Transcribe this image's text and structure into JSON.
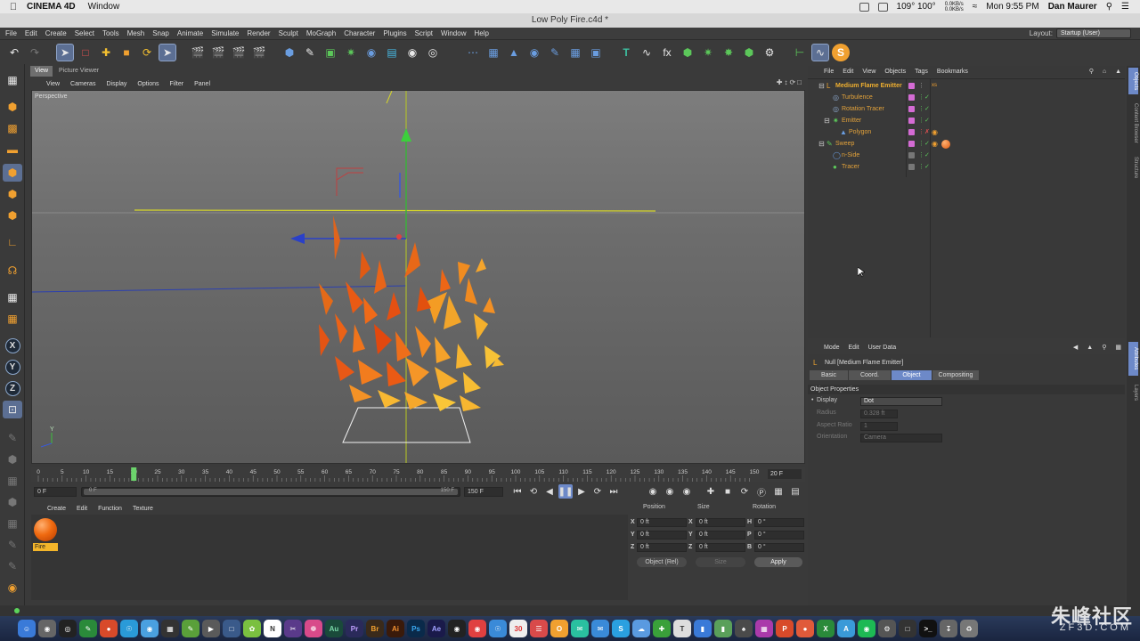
{
  "mac_menubar": {
    "app_name": "CINEMA 4D",
    "menu": "Window",
    "status_right": {
      "temperature": "109° 100°",
      "network_up": "0.0KB/s",
      "network_down": "0.0KB/s",
      "clock": "Mon 9:55 PM",
      "user": "Dan Maurer"
    }
  },
  "window": {
    "title": "Low Poly Fire.c4d *"
  },
  "app_menu": [
    "File",
    "Edit",
    "Create",
    "Select",
    "Tools",
    "Mesh",
    "Snap",
    "Animate",
    "Simulate",
    "Render",
    "Sculpt",
    "MoGraph",
    "Character",
    "Plugins",
    "Script",
    "Window",
    "Help"
  ],
  "layout": {
    "label": "Layout:",
    "value": "Startup (User)"
  },
  "viewport": {
    "tabs": [
      "View",
      "Picture Viewer"
    ],
    "menu": [
      "View",
      "Cameras",
      "Display",
      "Options",
      "Filter",
      "Panel"
    ],
    "camera_label": "Perspective",
    "axis_y": "Y"
  },
  "timeline": {
    "ticks": [
      "0",
      "5",
      "10",
      "15",
      "20",
      "25",
      "30",
      "35",
      "40",
      "45",
      "50",
      "55",
      "60",
      "65",
      "70",
      "75",
      "80",
      "85",
      "90",
      "95",
      "100",
      "105",
      "110",
      "115",
      "120",
      "125",
      "130",
      "135",
      "140",
      "145",
      "150"
    ],
    "current_frame": "20 F",
    "playhead_frame": 20,
    "start": "0 F",
    "range_start": "0 F",
    "range_end": "150 F",
    "end": "150 F"
  },
  "material_manager": {
    "menu": [
      "Create",
      "Edit",
      "Function",
      "Texture"
    ],
    "material_name": "Fire"
  },
  "coord_manager": {
    "headers": [
      "Position",
      "Size",
      "Rotation"
    ],
    "rows": [
      {
        "axis": "X",
        "pos": "0 ft",
        "size_axis": "X",
        "size": "0 ft",
        "rot_axis": "H",
        "rot": "0 °"
      },
      {
        "axis": "Y",
        "pos": "0 ft",
        "size_axis": "Y",
        "size": "0 ft",
        "rot_axis": "P",
        "rot": "0 °"
      },
      {
        "axis": "Z",
        "pos": "0 ft",
        "size_axis": "Z",
        "size": "0 ft",
        "rot_axis": "B",
        "rot": "0 °"
      }
    ],
    "mode": "Object (Rel)",
    "size_mode": "Size",
    "apply": "Apply"
  },
  "object_manager": {
    "menu": [
      "File",
      "Edit",
      "View",
      "Objects",
      "Tags",
      "Bookmarks"
    ],
    "objects": [
      {
        "name": "Medium Flame Emitter",
        "icon": "null-icon"
      },
      {
        "name": "Turbulence",
        "icon": "turbulence-icon"
      },
      {
        "name": "Rotation Tracer",
        "icon": "tracer-icon"
      },
      {
        "name": "Emitter",
        "icon": "emitter-icon"
      },
      {
        "name": "Polygon",
        "icon": "polygon-icon"
      },
      {
        "name": "Sweep",
        "icon": "sweep-icon"
      },
      {
        "name": "n-Side",
        "icon": "nside-icon"
      },
      {
        "name": "Tracer",
        "icon": "tracer-icon"
      }
    ]
  },
  "attribute_manager": {
    "menu": [
      "Mode",
      "Edit",
      "User Data"
    ],
    "title": "Null [Medium Flame Emitter]",
    "tabs": [
      "Basic",
      "Coord.",
      "Object",
      "Compositing"
    ],
    "active_tab": "Object",
    "section": "Object Properties",
    "props": [
      {
        "label": "Display",
        "value": "Dot"
      },
      {
        "label": "Radius",
        "value": "0.328 ft"
      },
      {
        "label": "Aspect Ratio",
        "value": "1"
      },
      {
        "label": "Orientation",
        "value": "Camera"
      }
    ]
  },
  "right_tabs": [
    "Objects",
    "Content Browser",
    "Structure",
    "Attributes",
    "Layers"
  ],
  "watermark": {
    "main": "朱峰社区",
    "sub": "ZF3D.COM"
  },
  "colors": {
    "accent_blue": "#6d89c8",
    "object_orange": "#e3a23a",
    "tag_pink": "#d46bd4",
    "fire_material": "#f06a10"
  }
}
